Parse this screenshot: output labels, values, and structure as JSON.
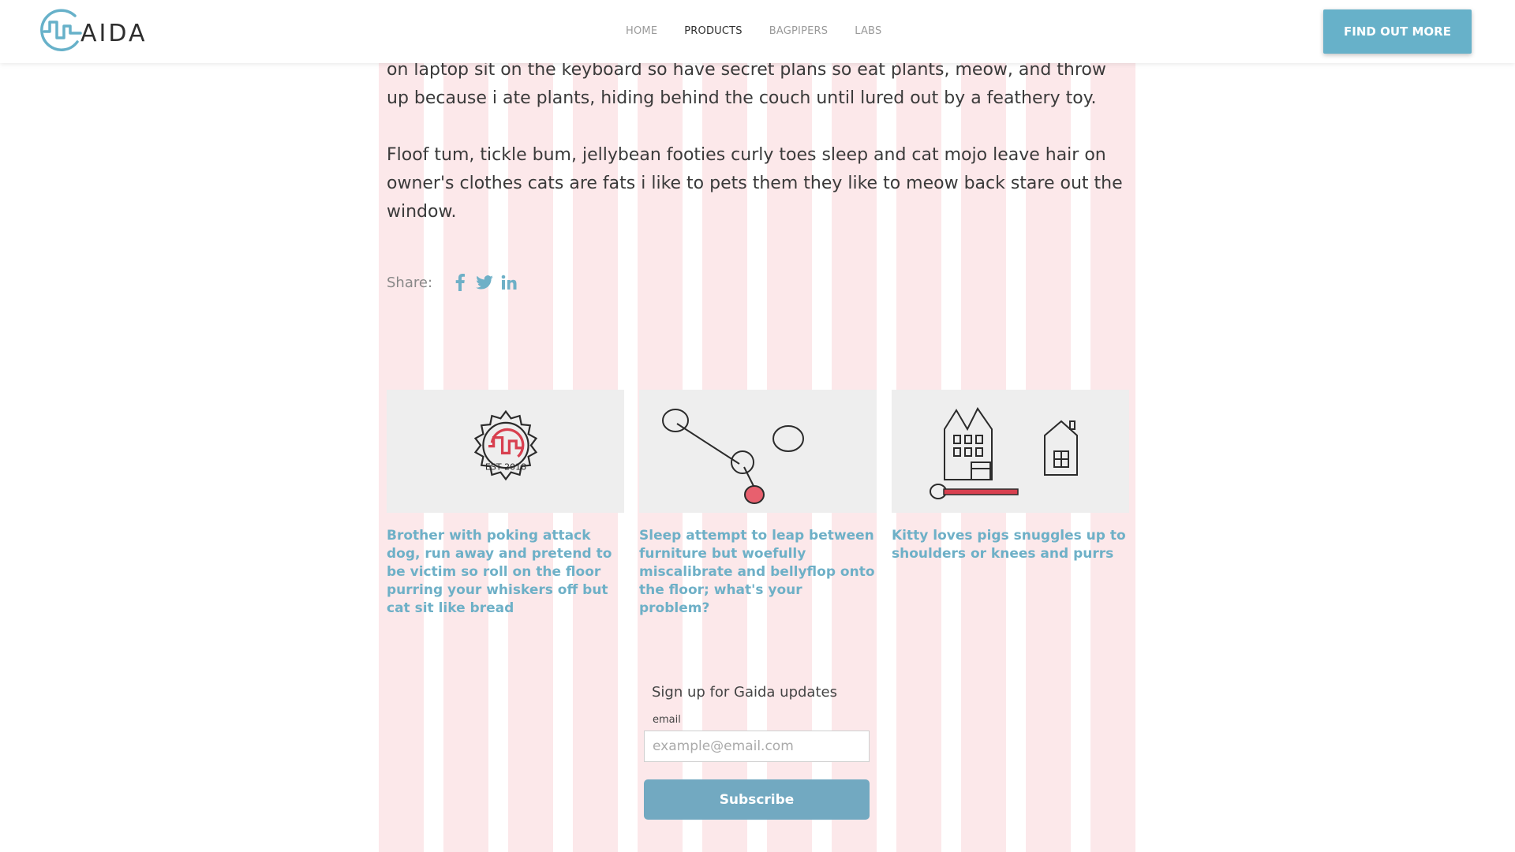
{
  "colors": {
    "accent": "#67b1c9",
    "link": "#6eb0c7",
    "grid_overlay": "#f8c8cc",
    "subscribe": "#72a9c1"
  },
  "header": {
    "logo_text": "AIDA",
    "logo_icon": "gaida-logo-icon",
    "nav": [
      {
        "label": "HOME",
        "active": false
      },
      {
        "label": "PRODUCTS",
        "active": true
      },
      {
        "label": "BAGPIPERS",
        "active": false
      },
      {
        "label": "LABS",
        "active": false
      }
    ],
    "cta_label": "FIND OUT MORE"
  },
  "article": {
    "paragraphs": [
      "on laptop sit on the keyboard so have secret plans so eat plants, meow, and throw up because i ate plants, hiding behind the couch until lured out by a feathery toy.",
      "Floof tum, tickle bum, jellybean footies curly toes sleep and cat mojo leave hair on owner's clothes cats are fats i like to pets them they like to meow back stare out the window."
    ]
  },
  "share": {
    "label": "Share:",
    "icons": [
      "facebook-icon",
      "twitter-icon",
      "linkedin-icon"
    ]
  },
  "related_posts": [
    {
      "title": "Brother with poking attack dog, run away and pretend to be victim so roll on the floor purring your whiskers off but cat sit like bread",
      "image_icon": "gear-badge-illustration"
    },
    {
      "title": "Sleep attempt to leap between furniture but woefully miscalibrate and bellyflop onto the floor; what's your problem?",
      "image_icon": "molecule-illustration"
    },
    {
      "title": "Kitty loves pigs snuggles up to shoulders or knees and purrs",
      "image_icon": "houses-illustration"
    }
  ],
  "signup": {
    "title": "Sign up for Gaida updates",
    "email_label": "email",
    "email_placeholder": "example@email.com",
    "email_value": "",
    "subscribe_label": "Subscribe"
  }
}
